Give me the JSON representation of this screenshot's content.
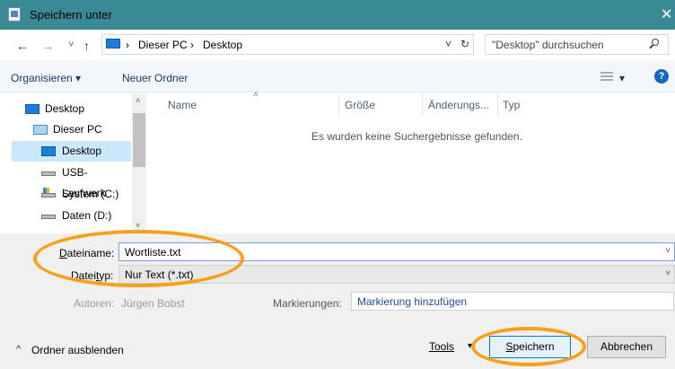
{
  "window": {
    "title": "Speichern unter",
    "close_glyph": "✕"
  },
  "address_bar": {
    "back_glyph": "←",
    "forward_glyph": "→",
    "recent_glyph": "˅",
    "up_glyph": "↑",
    "crumbs": [
      "Dieser PC",
      "Desktop"
    ],
    "crumb_separator": "›",
    "dropdown_glyph": "˅",
    "refresh_glyph": "↻",
    "search_placeholder": "\"Desktop\" durchsuchen"
  },
  "toolbar": {
    "organize": "Organisieren ▾",
    "new_folder": "Neuer Ordner",
    "view_dropdown_glyph": "▾",
    "help_glyph": "?"
  },
  "nav_pane": {
    "items": [
      {
        "label": "Desktop",
        "icon": "desktop-icon"
      },
      {
        "label": "Dieser PC",
        "icon": "pc-icon"
      },
      {
        "label": "Desktop",
        "icon": "desktop-icon",
        "selected": true
      },
      {
        "label": "USB-Laufwerk",
        "icon": "usb-drive-icon"
      },
      {
        "label": "System (C:)",
        "icon": "system-drive-icon"
      },
      {
        "label": "Daten (D:)",
        "icon": "drive-icon"
      }
    ],
    "scroll_up_glyph": "˄",
    "scroll_down_glyph": "˅"
  },
  "file_list": {
    "columns": [
      "Name",
      "Größe",
      "Änderungs...",
      "Typ"
    ],
    "sort_indicator": "˄",
    "empty_message": "Es wurden keine Suchergebnisse gefunden."
  },
  "form": {
    "filename_label": "Dateiname:",
    "filename_label_underlined": "D",
    "filename_label_rest": "ateiname:",
    "filename_value": "Wortliste.txt",
    "filetype_label_pre": "Datei",
    "filetype_label_u": "t",
    "filetype_label_post": "yp:",
    "filetype_value": "Nur Text (*.txt)",
    "authors_label": "Autoren:",
    "authors_value": "Jürgen Bobst",
    "tags_label": "Markierungen:",
    "tags_value": "Markierung hinzufügen",
    "dropdown_glyph": "˅"
  },
  "footer": {
    "hide_folders_glyph": "^",
    "hide_folders": "Ordner ausblenden",
    "tools_label": "Tools",
    "tools_dropdown_glyph": "▾",
    "save_label": "Speichern",
    "save_underlined": "S",
    "save_rest": "peichern",
    "cancel_label": "Abbrechen"
  },
  "colors": {
    "titlebar": "#3a8a96",
    "selection": "#cce8ff",
    "annotation_ring": "#f7a01c",
    "accent": "#0078d7"
  }
}
